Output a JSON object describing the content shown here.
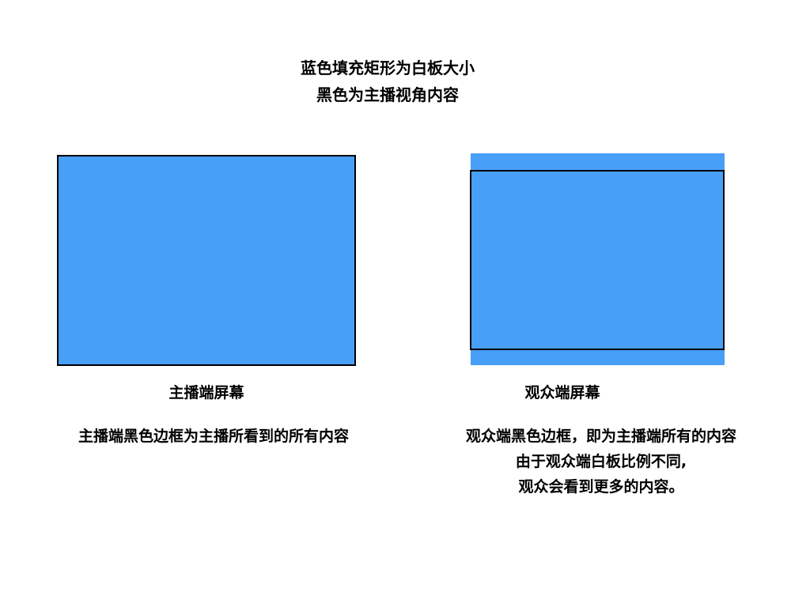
{
  "header": {
    "line1": "蓝色填充矩形为白板大小",
    "line2": "黑色为主播视角内容"
  },
  "host": {
    "label": "主播端屏幕",
    "description": "主播端黑色边框为主播所看到的所有内容"
  },
  "audience": {
    "label": "观众端屏幕",
    "description_lines": [
      "观众端黑色边框，即为主播端所有的内容",
      "由于观众端白板比例不同,",
      "观众会看到更多的内容。"
    ]
  },
  "colors": {
    "board_fill": "#489ff8",
    "frame_border": "#000000",
    "background": "#ffffff"
  }
}
